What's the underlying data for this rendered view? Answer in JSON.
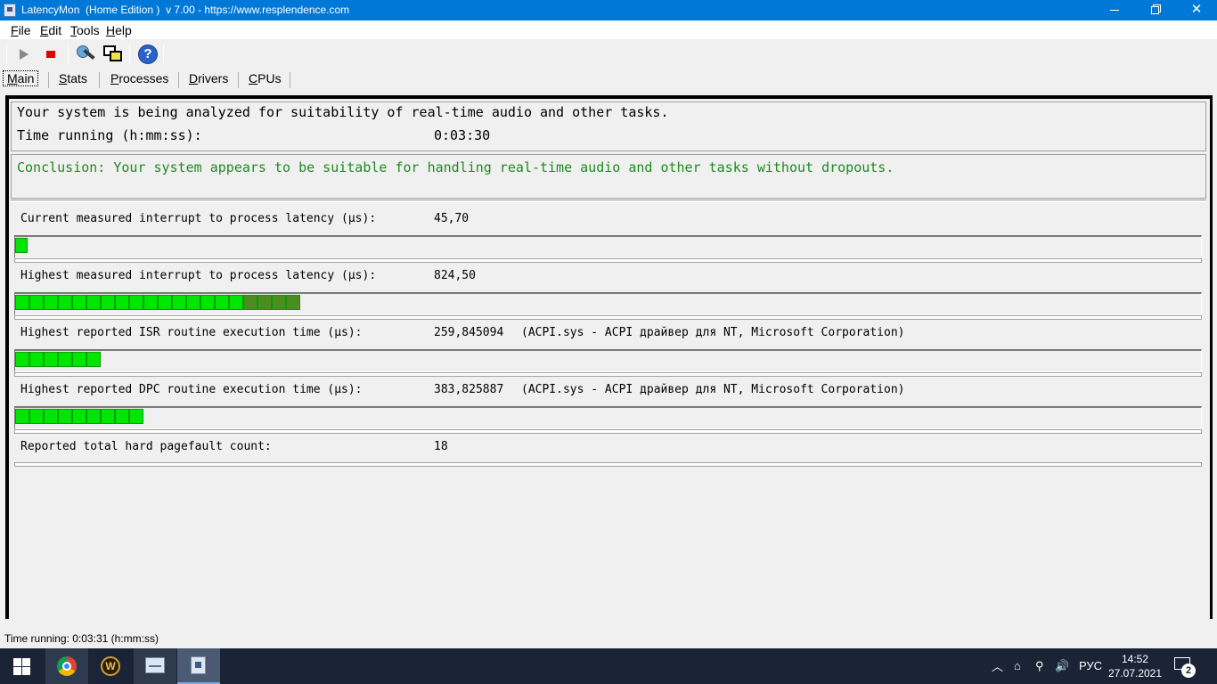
{
  "window": {
    "title": "LatencyMon  (Home Edition )  v 7.00 - https://www.resplendence.com",
    "close_glyph": "✕"
  },
  "menu": [
    "File",
    "Edit",
    "Tools",
    "Help"
  ],
  "toolbar": {
    "icons": [
      "play-icon",
      "stop-icon",
      "tool-icon",
      "windows-icon",
      "help-icon"
    ],
    "help_glyph": "?"
  },
  "tabs": [
    "Main",
    "Stats",
    "Processes",
    "Drivers",
    "CPUs"
  ],
  "status": {
    "analyzing": "Your system is being analyzed for suitability of real-time audio and other tasks.",
    "time_label": "Time running (h:mm:ss):",
    "time_value": "0:03:30",
    "conclusion": "Conclusion: Your system appears to be suitable for handling real-time audio and other tasks without dropouts."
  },
  "metrics": [
    {
      "label": "Current measured interrupt to process latency (µs):",
      "value": "45,70",
      "extra": "",
      "bar_segments": 1
    },
    {
      "label": "Highest measured interrupt to process latency (µs):",
      "value": "824,50",
      "extra": "",
      "bar_segments": 20
    },
    {
      "label": "Highest reported ISR routine execution time (µs):",
      "value": "259,845094",
      "extra": "(ACPI.sys - ACPI драйвер для NT, Microsoft Corporation)",
      "bar_segments": 6
    },
    {
      "label": "Highest reported DPC routine execution time (µs):",
      "value": "383,825887",
      "extra": "(ACPI.sys - ACPI драйвер для NT, Microsoft Corporation)",
      "bar_segments": 9
    },
    {
      "label": "Reported total hard pagefault count:",
      "value": "18",
      "extra": ""
    }
  ],
  "colors": {
    "bar_green": "#00e600",
    "bar_dark_green": "#4d8c1e",
    "conclusion_green": "#1f8a1f",
    "titlebar_blue": "#0078d7"
  },
  "statusbar": {
    "text": "Time running: 0:03:31  (h:mm:ss)"
  },
  "taskbar": {
    "apps": [
      "windows-start",
      "chrome",
      "world-of-warcraft",
      "resource-monitor",
      "latencymon"
    ],
    "wow_glyph": "W",
    "tray_up_glyph": "︿",
    "tray_glyphs": [
      "⌂",
      "⚲",
      "🔊"
    ],
    "language": "РУС",
    "time": "14:52",
    "date": "27.07.2021",
    "notification_count": "2"
  }
}
